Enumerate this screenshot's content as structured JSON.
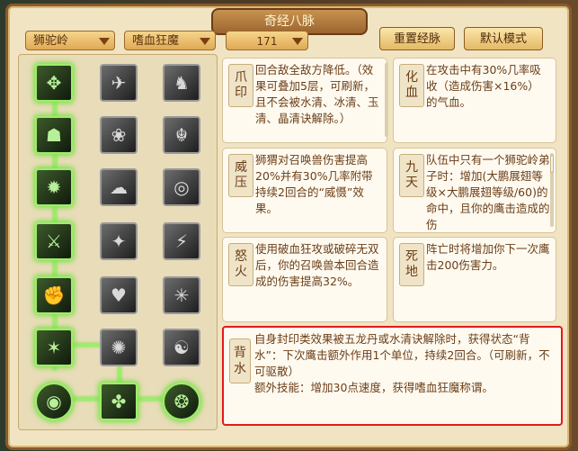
{
  "window": {
    "title": "奇经八脉"
  },
  "toolbar": {
    "dropdown1": "狮驼岭",
    "dropdown2": "嗜血狂魔",
    "points": "171",
    "reset_label": "重置经脉",
    "default_label": "默认模式"
  },
  "tree": {
    "icons": [
      "paw",
      "eagle",
      "tiger",
      "mask",
      "lotus",
      "dragon",
      "fierce",
      "cloud",
      "ring",
      "claw",
      "bird",
      "blade",
      "fist",
      "heart",
      "web",
      "star",
      "burst",
      "spiral",
      "orb",
      "beast",
      "swirl"
    ]
  },
  "skills": [
    {
      "name": "爪印",
      "text": "回合敌全敌方降低。（效果可叠加5层，可刷新，且不会被水清、冰清、玉清、晶清诀解除。）"
    },
    {
      "name": "化血",
      "text": "在攻击中有30%几率吸收（造成伤害×16%）的气血。"
    },
    {
      "name": "威压",
      "text": "狮猬对召唤兽伤害提高20%并有30%几率附带持续2回合的“威慑”效果。"
    },
    {
      "name": "九天",
      "text": "队伍中只有一个狮驼岭弟子时：增加(大鹏展翅等级×大鹏展翅等级/60)的命中，且你的鹰击造成的伤"
    },
    {
      "name": "怒火",
      "text": "使用破血狂攻或破碎无双后，你的召唤兽本回合造成的伤害提高32%。"
    },
    {
      "name": "死地",
      "text": "阵亡时将增加你下一次鹰击200伤害力。"
    }
  ],
  "selected": {
    "name": "背水",
    "line1": "自身封印类效果被五龙丹或水清诀解除时，获得状态“背水”：下次鹰击额外作用1个单位，持续2回合。（可刷新，不可驱散）",
    "line2": "额外技能：增加30点速度，获得嗜血狂魔称谓。"
  },
  "colors": {
    "active_glow": "#7fe04a",
    "highlight_border": "#e11a1a",
    "text_brown": "#6b3e17"
  }
}
